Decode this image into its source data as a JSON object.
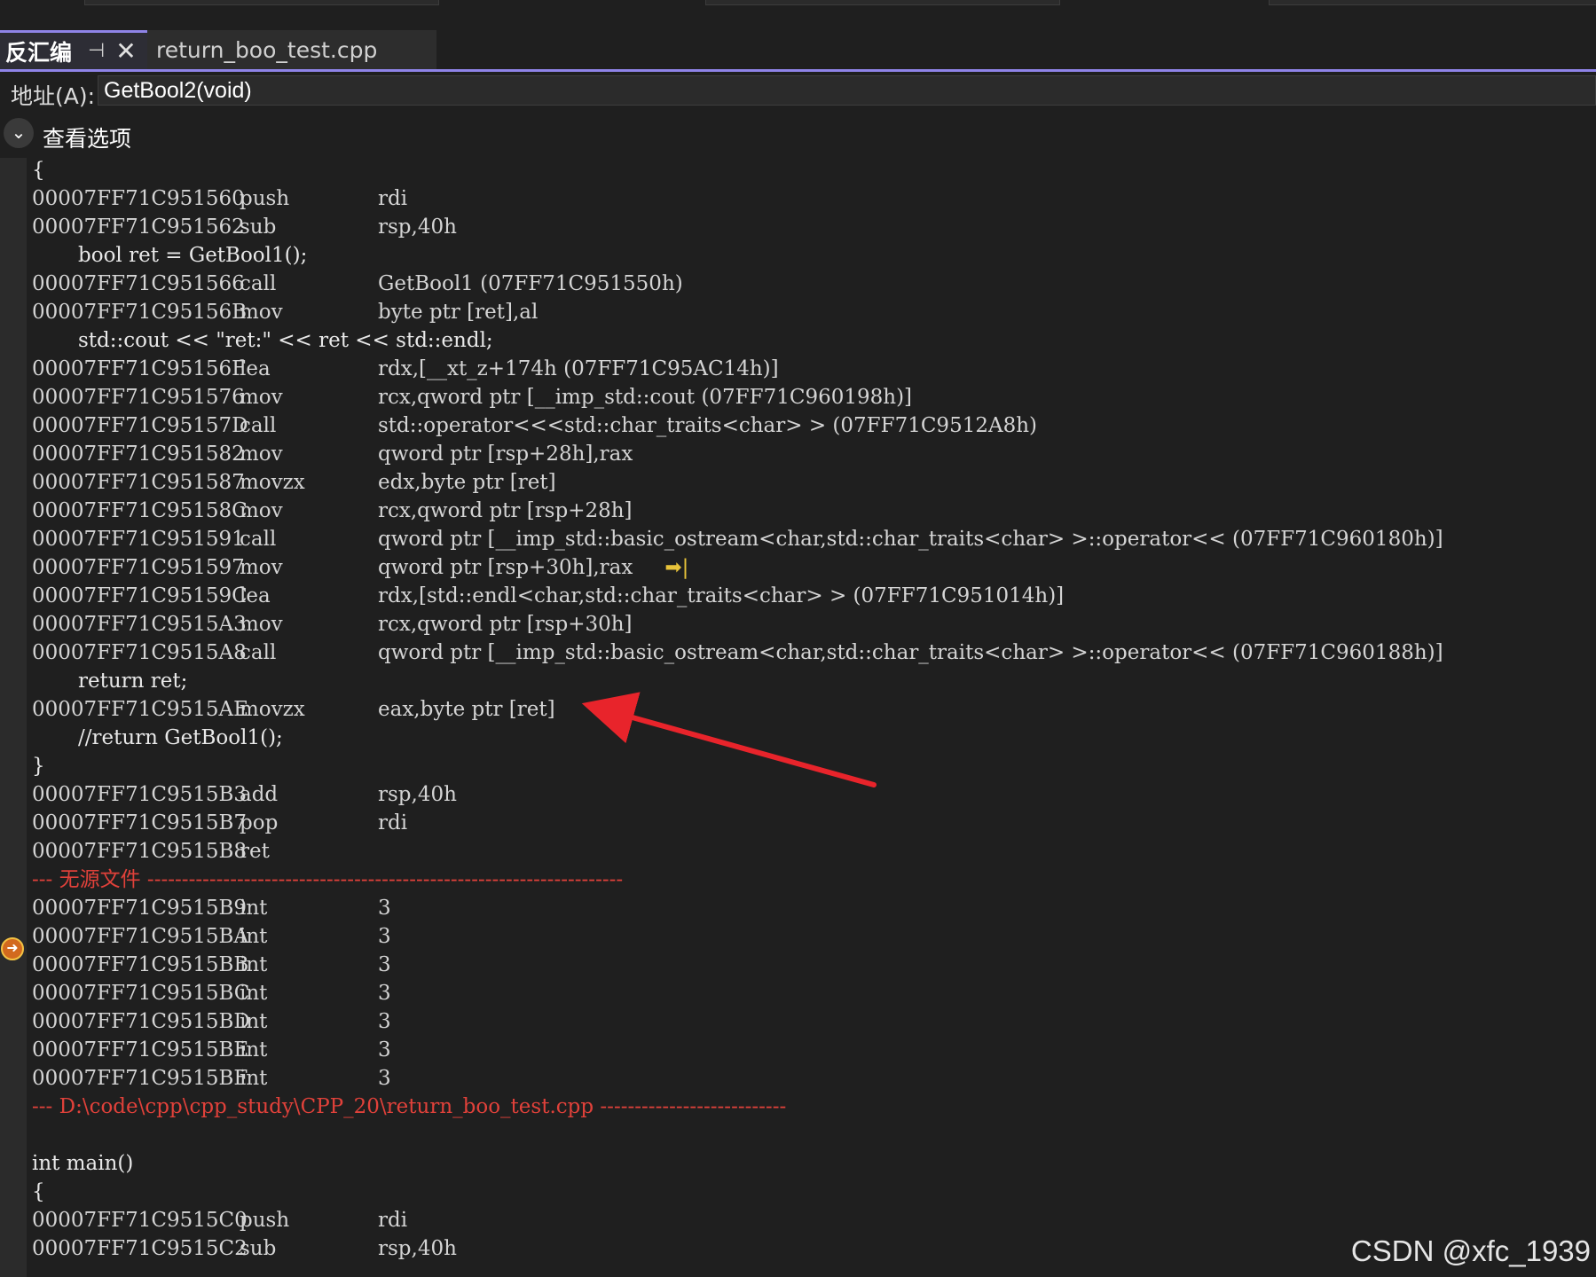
{
  "tabs": {
    "active_label": "反汇编",
    "pin_icon": "pin-icon",
    "close_icon": "close-icon",
    "file_label": "return_boo_test.cpp"
  },
  "address": {
    "label": "地址(A):",
    "value": "GetBool2(void)"
  },
  "view_options": {
    "label": "查看选项"
  },
  "lines": [
    {
      "kind": "brace",
      "text": "{"
    },
    {
      "kind": "asm",
      "addr": "00007FF71C951560",
      "op": "push",
      "args": "rdi"
    },
    {
      "kind": "asm",
      "addr": "00007FF71C951562",
      "op": "sub",
      "args": "rsp,40h"
    },
    {
      "kind": "src",
      "text": "bool ret = GetBool1();"
    },
    {
      "kind": "asm",
      "addr": "00007FF71C951566",
      "op": "call",
      "args": "GetBool1 (07FF71C951550h)"
    },
    {
      "kind": "asm",
      "addr": "00007FF71C95156B",
      "op": "mov",
      "args": "byte ptr [ret],al"
    },
    {
      "kind": "src",
      "text": "std::cout << \"ret:\" << ret << std::endl;"
    },
    {
      "kind": "asm",
      "addr": "00007FF71C95156F",
      "op": "lea",
      "args": "rdx,[__xt_z+174h (07FF71C95AC14h)]"
    },
    {
      "kind": "asm",
      "addr": "00007FF71C951576",
      "op": "mov",
      "args": "rcx,qword ptr [__imp_std::cout (07FF71C960198h)]"
    },
    {
      "kind": "asm",
      "addr": "00007FF71C95157D",
      "op": "call",
      "args": "std::operator<<<std::char_traits<char> > (07FF71C9512A8h)"
    },
    {
      "kind": "asm",
      "addr": "00007FF71C951582",
      "op": "mov",
      "args": "qword ptr [rsp+28h],rax"
    },
    {
      "kind": "asm",
      "addr": "00007FF71C951587",
      "op": "movzx",
      "args": "edx,byte ptr [ret]"
    },
    {
      "kind": "asm",
      "addr": "00007FF71C95158C",
      "op": "mov",
      "args": "rcx,qword ptr [rsp+28h]"
    },
    {
      "kind": "asm",
      "addr": "00007FF71C951591",
      "op": "call",
      "args": "qword ptr [__imp_std::basic_ostream<char,std::char_traits<char> >::operator<< (07FF71C960180h)]"
    },
    {
      "kind": "asm",
      "addr": "00007FF71C951597",
      "op": "mov",
      "args": "qword ptr [rsp+30h],rax",
      "bookmark": true
    },
    {
      "kind": "asm",
      "addr": "00007FF71C95159C",
      "op": "lea",
      "args": "rdx,[std::endl<char,std::char_traits<char> > (07FF71C951014h)]"
    },
    {
      "kind": "asm",
      "addr": "00007FF71C9515A3",
      "op": "mov",
      "args": "rcx,qword ptr [rsp+30h]"
    },
    {
      "kind": "asm",
      "addr": "00007FF71C9515A8",
      "op": "call",
      "args": "qword ptr [__imp_std::basic_ostream<char,std::char_traits<char> >::operator<< (07FF71C960188h)]"
    },
    {
      "kind": "src",
      "text": "return ret;"
    },
    {
      "kind": "asm",
      "addr": "00007FF71C9515AE",
      "op": "movzx",
      "args": "eax,byte ptr [ret]"
    },
    {
      "kind": "src",
      "text": "//return GetBool1();"
    },
    {
      "kind": "brace",
      "text": "}"
    },
    {
      "kind": "asm",
      "addr": "00007FF71C9515B3",
      "op": "add",
      "args": "rsp,40h"
    },
    {
      "kind": "asm",
      "addr": "00007FF71C9515B7",
      "op": "pop",
      "args": "rdi"
    },
    {
      "kind": "asm",
      "addr": "00007FF71C9515B8",
      "op": "ret",
      "args": ""
    },
    {
      "kind": "sep",
      "text": "--- 无源文件 ---------------------------------------------------------------------"
    },
    {
      "kind": "asm",
      "addr": "00007FF71C9515B9",
      "op": "int",
      "args": "3"
    },
    {
      "kind": "asm",
      "addr": "00007FF71C9515BA",
      "op": "int",
      "args": "3"
    },
    {
      "kind": "asm",
      "addr": "00007FF71C9515BB",
      "op": "int",
      "args": "3"
    },
    {
      "kind": "asm",
      "addr": "00007FF71C9515BC",
      "op": "int",
      "args": "3"
    },
    {
      "kind": "asm",
      "addr": "00007FF71C9515BD",
      "op": "int",
      "args": "3"
    },
    {
      "kind": "asm",
      "addr": "00007FF71C9515BE",
      "op": "int",
      "args": "3"
    },
    {
      "kind": "asm",
      "addr": "00007FF71C9515BF",
      "op": "int",
      "args": "3"
    },
    {
      "kind": "sep",
      "text": "--- D:\\code\\cpp\\cpp_study\\CPP_20\\return_boo_test.cpp ---------------------------"
    },
    {
      "kind": "blank",
      "text": ""
    },
    {
      "kind": "brace",
      "text": "int main()"
    },
    {
      "kind": "brace",
      "text": "{"
    },
    {
      "kind": "asm",
      "addr": "00007FF71C9515C0",
      "op": "push",
      "args": "rdi"
    },
    {
      "kind": "asm",
      "addr": "00007FF71C9515C2",
      "op": "sub",
      "args": "rsp,40h"
    }
  ],
  "icons": {
    "chevron": "chevron-down-icon",
    "current_instruction": "instruction-pointer-icon",
    "bookmark": "run-to-cursor-icon"
  },
  "colors": {
    "accent": "#8f84e8",
    "separator": "#e0413a",
    "arrow": "#e8242b",
    "pointer": "#d2691e"
  },
  "watermark": "CSDN @xfc_1939"
}
